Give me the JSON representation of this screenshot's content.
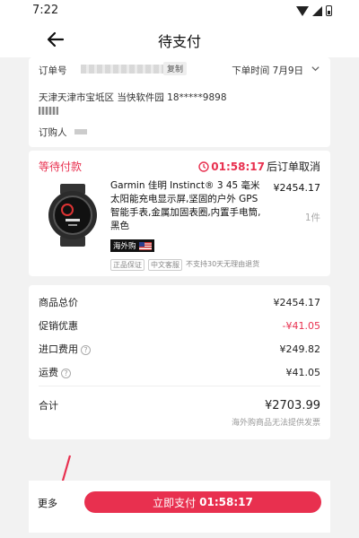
{
  "status_bar": {
    "time": "7:22"
  },
  "header": {
    "title": "待支付"
  },
  "order_info": {
    "order_no_label": "订单号",
    "copy_label": "复制",
    "order_time": "下单时间 7月9日",
    "address": "天津天津市宝坻区  当快软件园  18*****9898",
    "orderer_label": "订购人"
  },
  "product_card": {
    "status": "等待付款",
    "countdown_time": "01:58:17",
    "countdown_suffix": "后订单取消",
    "title": "Garmin 佳明 Instinct® 3 45 毫米太阳能充电显示屏,坚固的户外 GPS 智能手表,金属加固表圈,内置手电筒,黑色",
    "price": "¥2454.17",
    "quantity": "1件",
    "badge": "海外购",
    "tags": [
      "正品保证",
      "中文客服"
    ],
    "return_note": "不支持30天无理由退货"
  },
  "summary": {
    "rows": [
      {
        "label": "商品总价",
        "value": "¥2454.17"
      },
      {
        "label": "促销优惠",
        "value": "-¥41.05"
      },
      {
        "label": "进口费用",
        "value": "¥249.82"
      },
      {
        "label": "运费",
        "value": "¥41.05"
      }
    ],
    "total_label": "合计",
    "total_value": "¥2703.99",
    "footnote": "海外购商品无法提供发票"
  },
  "bottom_bar": {
    "more_label": "更多",
    "pay_label": "立即支付",
    "pay_time": "01:58:17"
  },
  "colors": {
    "accent": "#e8304f",
    "background": "#f2f2f2"
  }
}
